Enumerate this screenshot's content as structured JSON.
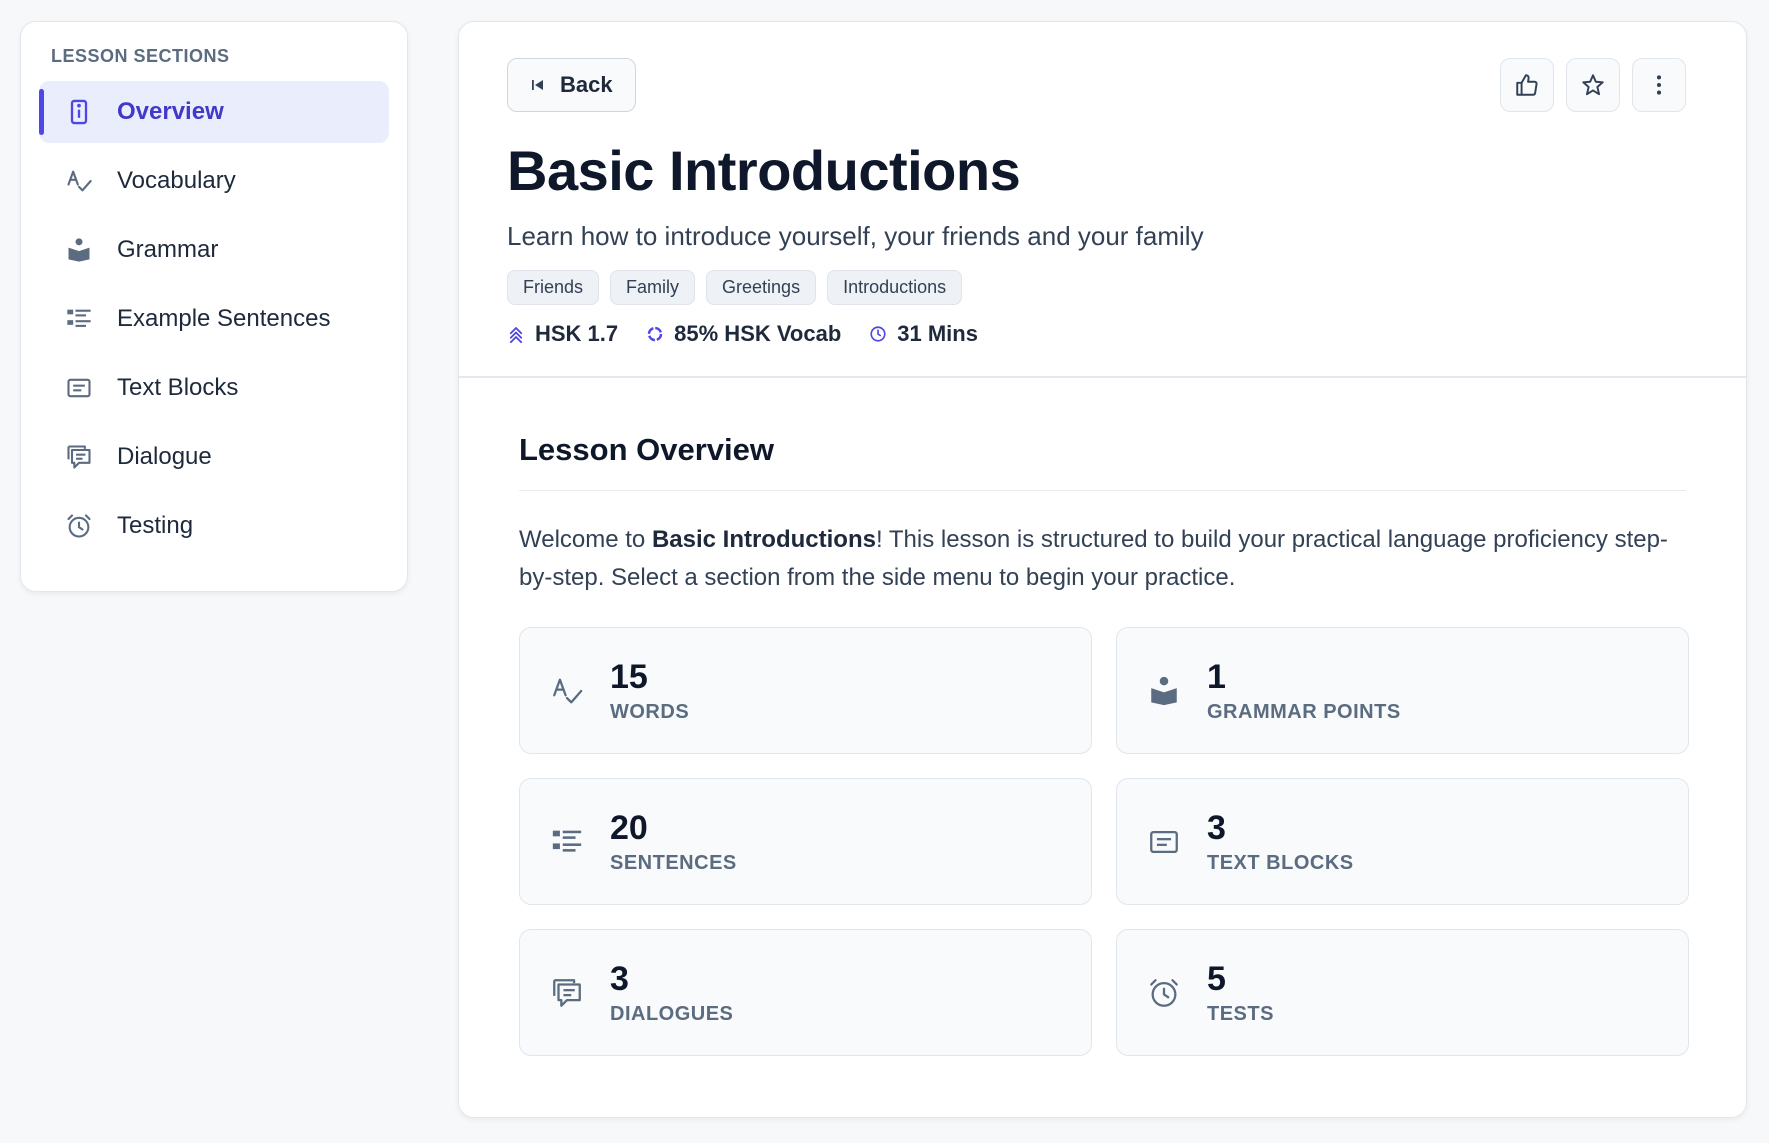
{
  "sidebar": {
    "heading": "LESSON SECTIONS",
    "items": [
      {
        "label": "Overview",
        "icon": "info-icon",
        "active": true
      },
      {
        "label": "Vocabulary",
        "icon": "spellcheck-icon"
      },
      {
        "label": "Grammar",
        "icon": "reading-icon"
      },
      {
        "label": "Example Sentences",
        "icon": "list-icon"
      },
      {
        "label": "Text Blocks",
        "icon": "text-block-icon"
      },
      {
        "label": "Dialogue",
        "icon": "chat-icon"
      },
      {
        "label": "Testing",
        "icon": "alarm-icon"
      }
    ]
  },
  "header": {
    "back_label": "Back",
    "title": "Basic Introductions",
    "subtitle": "Learn how to introduce yourself, your friends and your family",
    "tags": [
      "Friends",
      "Family",
      "Greetings",
      "Introductions"
    ],
    "meta": {
      "hsk_level": "HSK 1.7",
      "vocab_coverage": "85% HSK Vocab",
      "duration": "31 Mins"
    }
  },
  "overview": {
    "section_title": "Lesson Overview",
    "intro_prefix": "Welcome to ",
    "intro_bold": "Basic Introductions",
    "intro_suffix": "! This lesson is structured to build your practical language proficiency step-by-step. Select a section from the side menu to begin your practice.",
    "stats": [
      {
        "value": "15",
        "label": "WORDS",
        "icon": "spellcheck-icon"
      },
      {
        "value": "1",
        "label": "GRAMMAR POINTS",
        "icon": "reading-icon"
      },
      {
        "value": "20",
        "label": "SENTENCES",
        "icon": "list-icon"
      },
      {
        "value": "3",
        "label": "TEXT BLOCKS",
        "icon": "text-block-icon"
      },
      {
        "value": "3",
        "label": "DIALOGUES",
        "icon": "chat-icon"
      },
      {
        "value": "5",
        "label": "TESTS",
        "icon": "alarm-icon"
      }
    ]
  },
  "colors": {
    "accent": "#4f46e5",
    "active_bg": "#eaeefc",
    "icon_gray": "#5b6b80"
  }
}
